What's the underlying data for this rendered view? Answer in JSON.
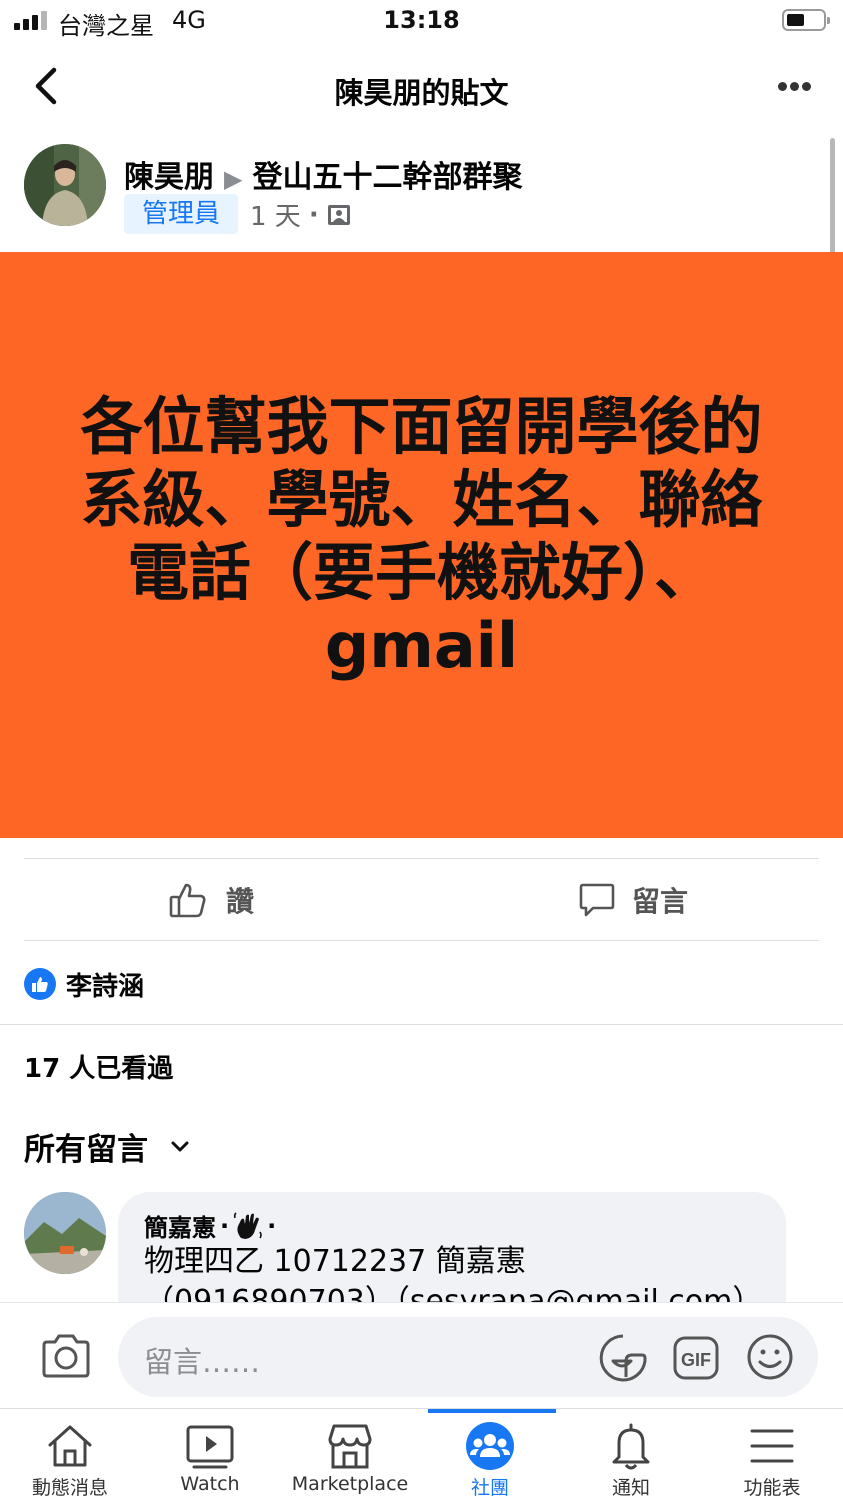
{
  "status_bar": {
    "carrier": "台灣之星",
    "network": "4G",
    "time": "13:18"
  },
  "nav": {
    "title": "陳昊朋的貼文"
  },
  "post": {
    "author": "陳昊朋",
    "group": "登山五十二幹部群聚",
    "role_badge": "管理員",
    "time_ago": "1 天",
    "banner_color": "#fe6625",
    "banner_lines": [
      "各位幫我下面留開學後的",
      "系級、學號、姓名、聯絡",
      "電話（要手機就好）、",
      "gmail"
    ]
  },
  "actions": {
    "like_label": "讚",
    "comment_label": "留言"
  },
  "reactions": {
    "liker": "李詩涵"
  },
  "seen": {
    "text": "17 人已看過"
  },
  "comments": {
    "filter_label": "所有留言",
    "items": [
      {
        "author": "簡嘉憲",
        "line1": "物理四乙 10712237 簡嘉憲",
        "line2": "（0916890703）（sesyrana@gmail.com）"
      }
    ]
  },
  "composer": {
    "placeholder": "留言……",
    "gif_label": "GIF"
  },
  "tab_bar": {
    "accent": "#1877f2",
    "tabs": [
      {
        "label": "動態消息",
        "icon": "home-icon"
      },
      {
        "label": "Watch",
        "icon": "watch-icon"
      },
      {
        "label": "Marketplace",
        "icon": "marketplace-icon"
      },
      {
        "label": "社團",
        "icon": "groups-icon",
        "active": true
      },
      {
        "label": "通知",
        "icon": "bell-icon"
      },
      {
        "label": "功能表",
        "icon": "menu-icon"
      }
    ]
  }
}
